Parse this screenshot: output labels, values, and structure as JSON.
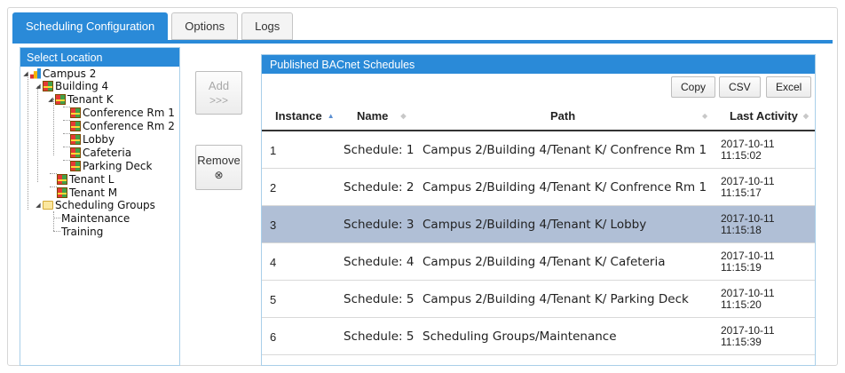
{
  "tabs": [
    "Scheduling Configuration",
    "Options",
    "Logs"
  ],
  "location_panel": {
    "title": "Select Location",
    "tree": {
      "campus": "Campus 2",
      "building": "Building 4",
      "tenant_k": "Tenant K",
      "rooms": [
        "Conference Rm 1",
        "Conference Rm 2",
        "Lobby",
        "Cafeteria",
        "Parking Deck"
      ],
      "tenant_l": "Tenant L",
      "tenant_m": "Tenant M",
      "groups": "Scheduling Groups",
      "group_items": [
        "Maintenance",
        "Training"
      ]
    }
  },
  "actions": {
    "add_label": "Add",
    "add_glyph": ">>>",
    "remove_label": "Remove",
    "remove_glyph": "⊗"
  },
  "published": {
    "title": "Published BACnet Schedules",
    "toolbar": {
      "copy": "Copy",
      "csv": "CSV",
      "excel": "Excel"
    },
    "columns": {
      "instance": "Instance",
      "name": "Name",
      "path": "Path",
      "last_activity": "Last Activity"
    },
    "rows": [
      {
        "instance": "1",
        "name": "Schedule: 1",
        "path": "Campus 2/Building 4/Tenant K/ Confrence Rm 1",
        "date": "2017-10-11",
        "time": "11:15:02"
      },
      {
        "instance": "2",
        "name": "Schedule: 2",
        "path": "Campus 2/Building 4/Tenant K/ Confrence Rm 1",
        "date": "2017-10-11",
        "time": "11:15:17"
      },
      {
        "instance": "3",
        "name": "Schedule: 3",
        "path": "Campus 2/Building 4/Tenant K/ Lobby",
        "date": "2017-10-11",
        "time": "11:15:18"
      },
      {
        "instance": "4",
        "name": "Schedule: 4",
        "path": "Campus 2/Building 4/Tenant K/ Cafeteria",
        "date": "2017-10-11",
        "time": "11:15:19"
      },
      {
        "instance": "5",
        "name": "Schedule: 5",
        "path": "Campus 2/Building 4/Tenant K/ Parking Deck",
        "date": "2017-10-11",
        "time": "11:15:20"
      },
      {
        "instance": "6",
        "name": "Schedule: 5",
        "path": "Scheduling Groups/Maintenance",
        "date": "2017-10-11",
        "time": "11:15:39"
      }
    ],
    "selected_row_instance": "3"
  },
  "colors": {
    "accent": "#2a8ad8",
    "selected_row": "#b0bfd6"
  }
}
